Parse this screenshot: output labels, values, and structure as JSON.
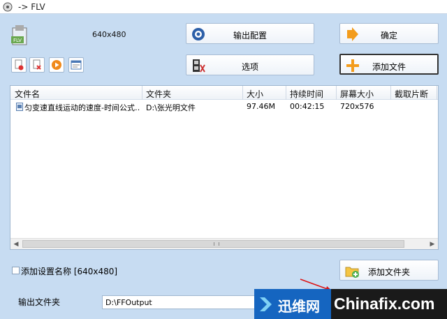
{
  "window": {
    "title": "-> FLV"
  },
  "profile": {
    "resolution": "640x480"
  },
  "buttons": {
    "output_config": "输出配置",
    "ok": "确定",
    "options": "选项",
    "add_file": "添加文件",
    "add_folder": "添加文件夹"
  },
  "table": {
    "headers": [
      "文件名",
      "文件夹",
      "大小",
      "持续时间",
      "屏幕大小",
      "截取片断"
    ],
    "rows": [
      {
        "name": "匀变速直线运动的速度-时间公式…",
        "folder": "D:\\张光明文件",
        "size": "97.46M",
        "duration": "00:42:15",
        "screen": "720x576"
      }
    ]
  },
  "add_setting_name": {
    "label": "添加设置名称 [640x480]"
  },
  "output": {
    "label": "输出文件夹",
    "value": "D:\\FFOutput"
  },
  "watermark": {
    "text1": "迅维网",
    "text2": "Chinafix.com"
  },
  "colors": {
    "background": "#c7dcf2",
    "accent": "#1565c0"
  }
}
